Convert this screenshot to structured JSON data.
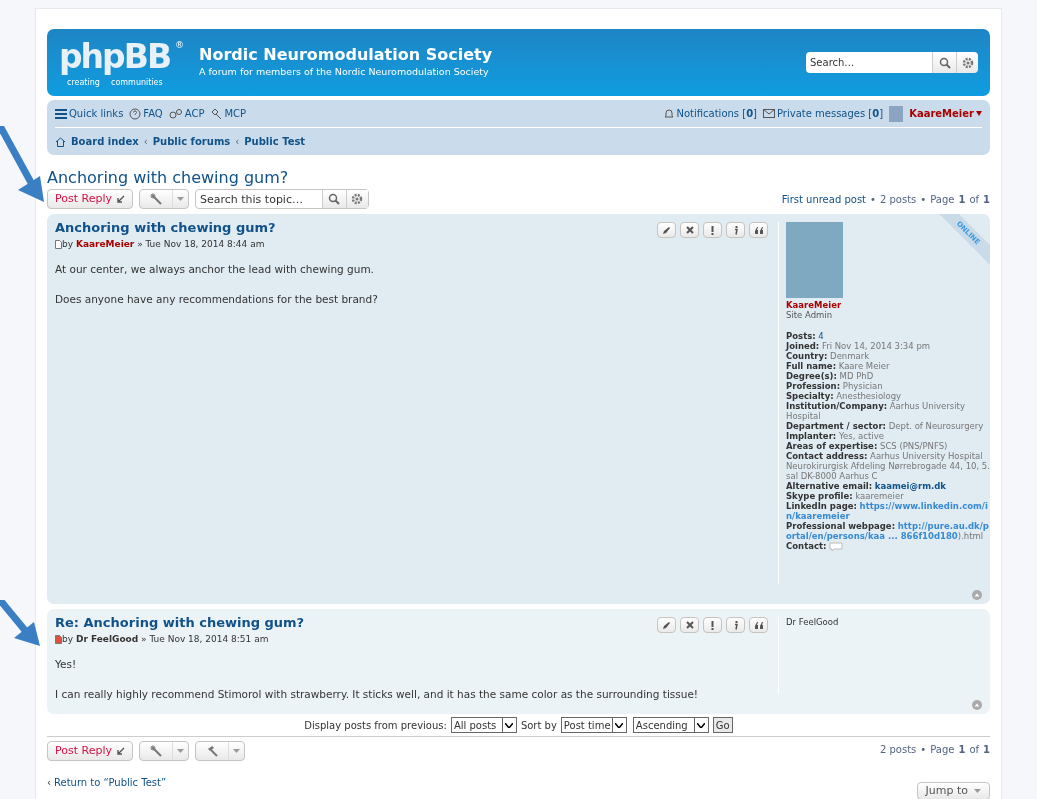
{
  "header": {
    "logo_main": "phpBB",
    "logo_mark": "®",
    "logo_sub1": "creating",
    "logo_sub2": "communities",
    "site_title": "Nordic Neuromodulation Society",
    "site_description": "A forum for members of the Nordic Neuromodulation Society",
    "search": {
      "placeholder": "Search…"
    }
  },
  "navbar": {
    "left": [
      {
        "kind": "menu",
        "label": "Quick links"
      },
      {
        "kind": "faq",
        "label": "FAQ"
      },
      {
        "kind": "acp",
        "label": "ACP"
      },
      {
        "kind": "mcp",
        "label": "MCP"
      }
    ],
    "notifications": {
      "label": "Notifications [**0**]"
    },
    "messages": {
      "label": "Private messages [**0**]"
    },
    "user": "KaareMeier",
    "breadcrumb_separator": "‹",
    "breadcrumbs": [
      "Board index",
      "Public forums",
      "Public Test"
    ]
  },
  "topic": {
    "title": "Anchoring with chewing gum?",
    "post_reply": "Post Reply",
    "search": {
      "placeholder": "Search this topic…"
    },
    "pagination": {
      "first_unread": "First unread post",
      "separator": "•",
      "posts": "2 posts",
      "page": "Page",
      "current": "1",
      "of": "of",
      "total": "1"
    }
  },
  "posts": [
    {
      "title": "Anchoring with chewing gum?",
      "unread": false,
      "by": "by",
      "author": "KaareMeier",
      "author_admin": true,
      "separator": "»",
      "date": "Tue Nov 18, 2014 8:44 am",
      "online": "ONLINE",
      "body": [
        "At our center, we always anchor the lead with chewing gum.",
        "Does anyone have any recommendations for the best brand?"
      ],
      "buttons": [
        {
          "kind": "edit"
        },
        {
          "kind": "delete"
        },
        {
          "kind": "report"
        },
        {
          "kind": "info"
        },
        {
          "kind": "quote"
        }
      ],
      "profile": {
        "avatar": true,
        "name": "KaareMeier",
        "rank": "Site Admin",
        "fields": [
          {
            "label": "Posts:",
            "parts": [
              {
                "text": "4",
                "kind": "link"
              }
            ]
          },
          {
            "label": "Joined:",
            "parts": [
              {
                "text": "Fri Nov 14, 2014 3:34 pm",
                "kind": "text"
              }
            ]
          },
          {
            "label": "Country:",
            "parts": [
              {
                "text": "Denmark",
                "kind": "text"
              }
            ]
          },
          {
            "label": "Full name:",
            "parts": [
              {
                "text": "Kaare Meier",
                "kind": "text"
              }
            ]
          },
          {
            "label": "Degree(s):",
            "parts": [
              {
                "text": "MD PhD",
                "kind": "text"
              }
            ]
          },
          {
            "label": "Profession:",
            "parts": [
              {
                "text": "Physician",
                "kind": "text"
              }
            ]
          },
          {
            "label": "Specialty:",
            "parts": [
              {
                "text": "Anesthesiology",
                "kind": "text"
              }
            ]
          },
          {
            "label": "Institution/Company:",
            "parts": [
              {
                "text": "Aarhus University Hospital",
                "kind": "text"
              }
            ]
          },
          {
            "label": "Department / sector:",
            "parts": [
              {
                "text": "Dept. of Neurosurgery",
                "kind": "text"
              }
            ]
          },
          {
            "label": "Implanter:",
            "parts": [
              {
                "text": "Yes, active",
                "kind": "text"
              }
            ]
          },
          {
            "label": "Areas of expertise:",
            "parts": [
              {
                "text": "SCS (PNS/PNFS)",
                "kind": "text"
              }
            ]
          },
          {
            "label": "Contact address:",
            "parts": [
              {
                "text": "Aarhus University Hospital Neurokirurgisk Afdeling Nørrebrogade 44, 10, 5. sal DK-8000 Aarhus C",
                "kind": "text"
              }
            ]
          },
          {
            "label": "Alternative email:",
            "parts": [
              {
                "text": "kaamei@rm.dk",
                "kind": "bold-link"
              }
            ]
          },
          {
            "label": "Skype profile:",
            "parts": [
              {
                "text": "kaaremeier",
                "kind": "text"
              }
            ]
          },
          {
            "label": "LinkedIn page:",
            "parts": [
              {
                "text": "https://www.linkedin.com/in/kaaremeier",
                "kind": "mono-link"
              }
            ]
          },
          {
            "label": "Professional webpage:",
            "parts": [
              {
                "text": "http://pure.au.dk/portal/en/persons/kaa ... 866f10d180",
                "kind": "mono-link"
              },
              {
                "text": ").html",
                "kind": "text"
              }
            ]
          },
          {
            "label": "Contact:",
            "parts": [
              {
                "kind": "contact-icon"
              }
            ]
          }
        ]
      }
    },
    {
      "title": "Re: Anchoring with chewing gum?",
      "unread": true,
      "by": "by",
      "author": "Dr FeelGood",
      "author_admin": false,
      "separator": "»",
      "date": "Tue Nov 18, 2014 8:51 am",
      "body": [
        "Yes!",
        "I can really highly recommend Stimorol with strawberry. It sticks well, and it has the same color as the surrounding tissue!"
      ],
      "buttons": [
        {
          "kind": "edit"
        },
        {
          "kind": "delete"
        },
        {
          "kind": "report"
        },
        {
          "kind": "info"
        },
        {
          "kind": "quote"
        }
      ],
      "profile": {
        "avatar": false,
        "name": "Dr FeelGood"
      }
    }
  ],
  "display": {
    "label": "Display posts from previous:",
    "posts": "All posts",
    "sort_label": "Sort by",
    "sort": "Post time",
    "order": "Ascending",
    "go": "Go"
  },
  "footer": {
    "post_reply": "Post Reply",
    "pagination": {
      "separator": "•",
      "posts": "2 posts",
      "page": "Page",
      "current": "1",
      "of": "of",
      "total": "1"
    },
    "return_chevron": "‹",
    "return": "Return to “Public Test”",
    "jump": "Jump to"
  }
}
